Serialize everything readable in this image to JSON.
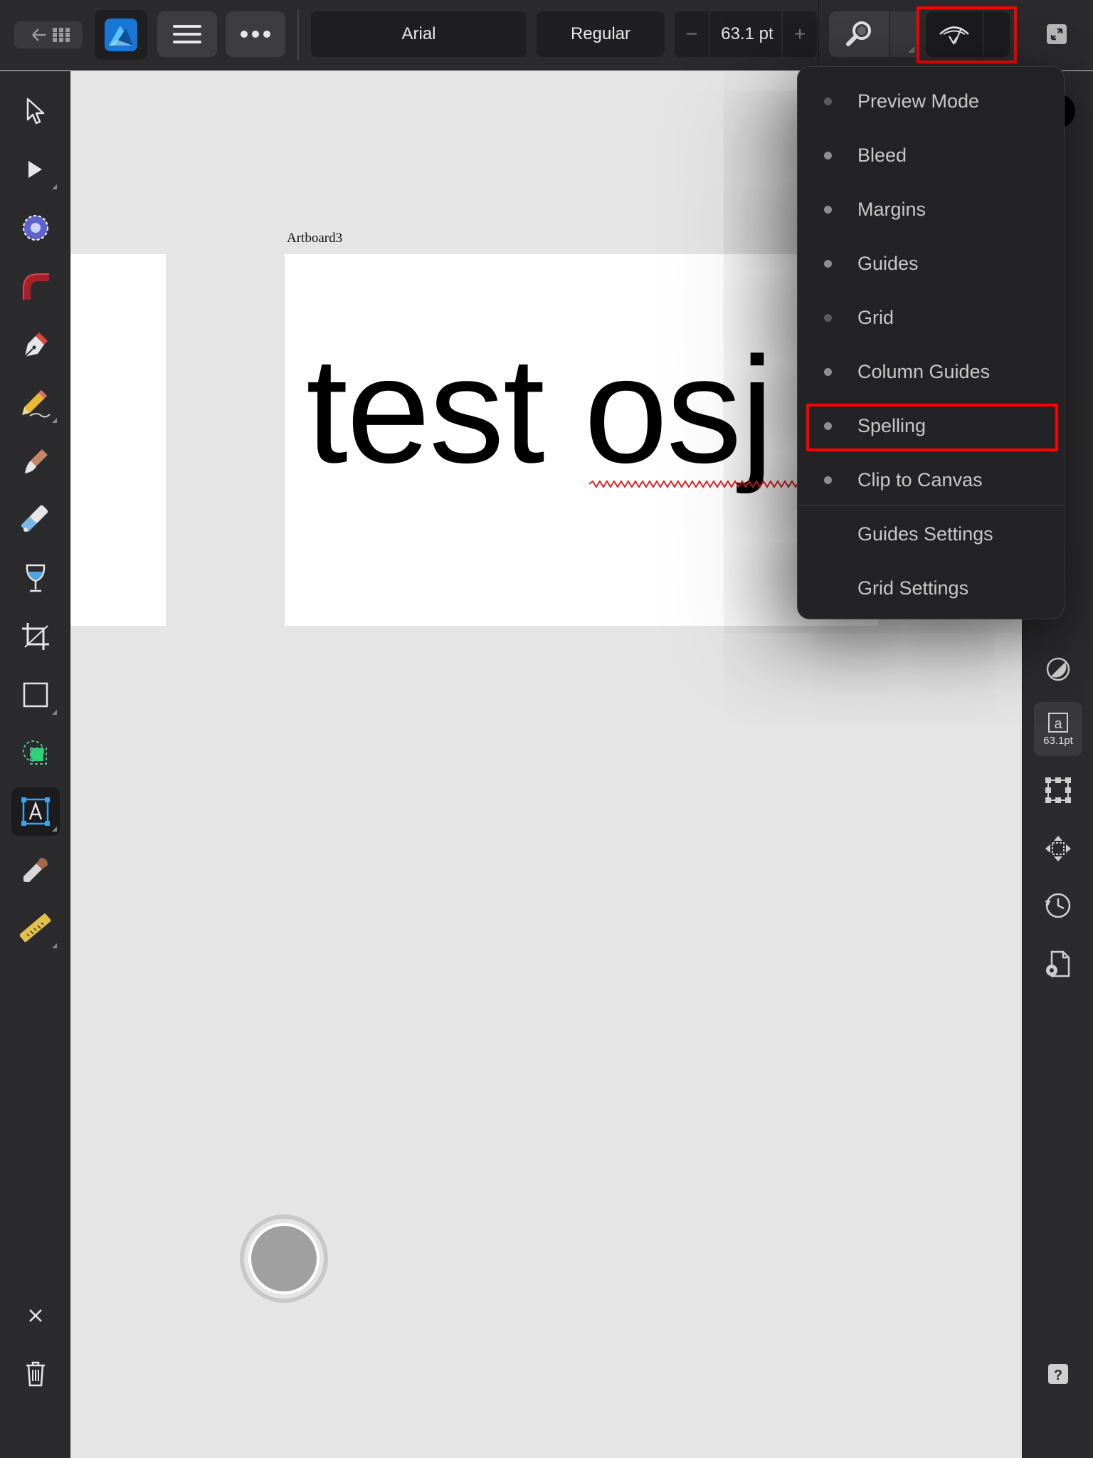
{
  "toolbar": {
    "font_family": "Arial",
    "font_style": "Regular",
    "font_size": "63.1 pt",
    "minus": "−",
    "plus": "+"
  },
  "canvas": {
    "artboard_label": "Artboard3",
    "text_content": "test osj"
  },
  "view_menu": {
    "items": [
      {
        "label": "Preview Mode",
        "dot": true
      },
      {
        "label": "Bleed",
        "dot": true
      },
      {
        "label": "Margins",
        "dot": true
      },
      {
        "label": "Guides",
        "dot": true
      },
      {
        "label": "Grid",
        "dot": true
      },
      {
        "label": "Column Guides",
        "dot": true
      },
      {
        "label": "Spelling",
        "dot": true
      },
      {
        "label": "Clip to Canvas",
        "dot": true
      },
      {
        "label": "Guides Settings",
        "dot": false
      },
      {
        "label": "Grid Settings",
        "dot": false
      }
    ]
  },
  "studio": {
    "character_size": "63.1pt"
  },
  "colors": {
    "highlight": "#ff0000",
    "toolbar_bg": "#2b2b2d",
    "canvas_bg": "#e5e5e5",
    "accent_blue": "#1e7ad6"
  }
}
